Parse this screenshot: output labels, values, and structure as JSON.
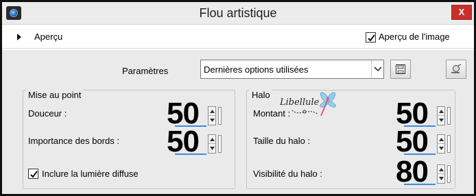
{
  "window": {
    "title": "Flou artistique",
    "close_icon": "close-icon",
    "close_glyph": "X",
    "app_icon": "app-icon"
  },
  "preview": {
    "label": "Aperçu",
    "image_preview_label": "Aperçu de l'image",
    "image_preview_checked": true
  },
  "params": {
    "label": "Paramètres",
    "preset_value": "Dernières options utilisées",
    "save_icon": "save-icon",
    "reset_icon": "reset-icon"
  },
  "focus": {
    "title": "Mise au point",
    "douceur_label": "Douceur :",
    "douceur_value": "50",
    "bords_label": "Importance des bords :",
    "bords_value": "50",
    "diffuse_label": "Inclure la lumière diffuse",
    "diffuse_checked": true
  },
  "halo": {
    "title": "Halo",
    "montant_label": "Montant :",
    "montant_value": "50",
    "taille_label": "Taille du halo :",
    "taille_value": "50",
    "visibilite_label": "Visibilité du halo :",
    "visibilite_value": "80"
  },
  "watermark": {
    "text": "Libellule"
  },
  "colors": {
    "accent": "#3b8de0",
    "close": "#c9302c",
    "panel": "#eaeaea"
  }
}
